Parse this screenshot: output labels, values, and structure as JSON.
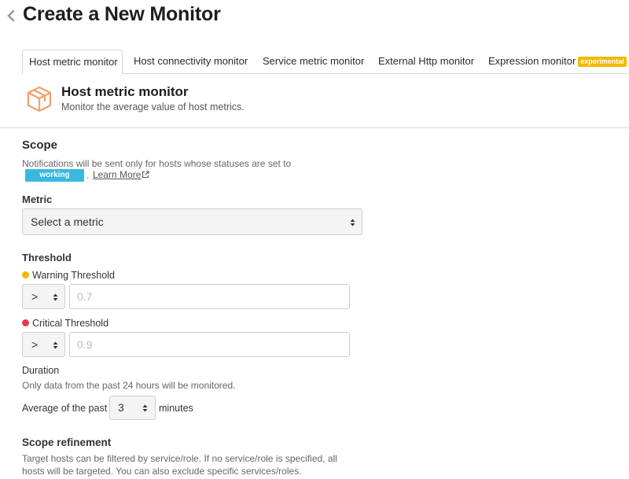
{
  "header": {
    "title": "Create a New Monitor"
  },
  "tabs": [
    {
      "label": "Host metric monitor",
      "active": true
    },
    {
      "label": "Host connectivity monitor"
    },
    {
      "label": "Service metric monitor"
    },
    {
      "label": "External Http monitor"
    },
    {
      "label": "Expression monitor",
      "badge": "experimental"
    }
  ],
  "monitor_type": {
    "title": "Host metric monitor",
    "description": "Monitor the average value of host metrics."
  },
  "scope": {
    "title": "Scope",
    "notice": "Notifications will be sent only for hosts whose statuses are set to",
    "status": "working",
    "separator": ".",
    "learn_more": "Learn More"
  },
  "metric": {
    "label": "Metric",
    "selected": "Select a metric"
  },
  "threshold": {
    "title": "Threshold",
    "warning": {
      "label": "Warning Threshold",
      "operator": ">",
      "placeholder": "0.7",
      "color": "#f2b705"
    },
    "critical": {
      "label": "Critical Threshold",
      "operator": ">",
      "placeholder": "0.9",
      "color": "#e8384f"
    }
  },
  "duration": {
    "title": "Duration",
    "note": "Only data from the past 24 hours will be monitored.",
    "prefix": "Average of the past",
    "value": "3",
    "suffix": "minutes"
  },
  "scope_refinement": {
    "title": "Scope refinement",
    "description_line1": "Target hosts can be filtered by service/role. If no service/role is specified, all",
    "description_line2": "hosts will be targeted. You can also exclude specific services/roles."
  },
  "colors": {
    "status_badge": "#39b9e0",
    "experimental_badge": "#f5b700",
    "cube_icon": "#f0a06b"
  }
}
